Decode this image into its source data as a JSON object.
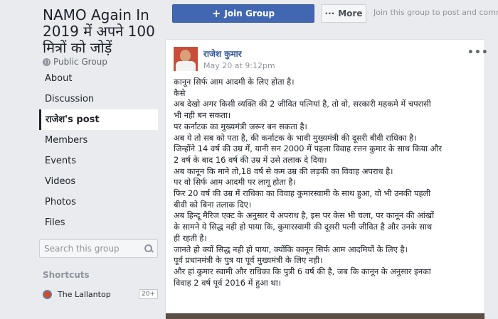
{
  "group": {
    "title": "NAMO Again In 2019 में अपने 100 मित्रों को जोड़ें",
    "type_label": "Public Group"
  },
  "nav": {
    "items": [
      {
        "label": "About"
      },
      {
        "label": "Discussion"
      },
      {
        "label": "राजेश's post"
      },
      {
        "label": "Members"
      },
      {
        "label": "Events"
      },
      {
        "label": "Videos"
      },
      {
        "label": "Photos"
      },
      {
        "label": "Files"
      }
    ],
    "active_index": 2
  },
  "search": {
    "placeholder": "Search this group"
  },
  "shortcuts": {
    "title": "Shortcuts",
    "items": [
      {
        "label": "The Lallantop",
        "badge": "20+"
      }
    ]
  },
  "topbar": {
    "join_label": "Join Group",
    "more_label": "More",
    "hint": "Join this group to post and comment"
  },
  "post": {
    "author": "राजेश कुमार",
    "timestamp": "May 20 at 9:12pm",
    "lines": [
      "कानून सिर्फ आम आदमी के लिए होता है।",
      "कैसे",
      "अब देखो अगर किसी व्यक्ति की 2 जीवित पत्नियां है, तो वो, सरकारी महकमे में चपरासी",
      "भी नही बन सकता।",
      "पर कर्नाटक का मुख्यमंत्री जरूर बन सकता है।",
      "अब ये तो सब को पता है, की कर्नाटक के भावी मुख्यमंत्री की दूसरी बीवी राधिका है।",
      "जिन्होंने 14 वर्ष की उम्र में, यानी सन 2000 में पहला विवाह रत्तन कुमार के साथ किया और",
      "2 वर्ष के बाद 16 वर्ष की उम्र में उसे तलाक दे दिया।",
      "अब कानून कि माने तो,18 वर्ष से कम उम्र की लड़की का विवाह अपराध है।",
      "पर वो सिर्फ आम आदमी पर लागू होता है।",
      "फिर 20 वर्ष की उम्र में राधिका का विवाह कुमारस्वामी के साथ हुआ, वो भी उनकी पहली",
      "बीवी को बिना तलाक दिए।",
      "अब हिन्दू मैरिज एक्ट के अनुसार ये अपराध है, इस पर केस भी चला, पर कानून की आंखों",
      "के सामने ये सिद्ध नही हो पाया कि, कुमारस्वामी की दूसरी पत्नी जीवित है और उनके साथ",
      "ही रहती है।",
      "जानते हो क्यों सिद्ध नही हो पाया, क्योंकि कानून सिर्फ आम आदमियों के लिए है।",
      "पूर्व प्रधानमंत्री के पुत्र या पूर्व मुख्यमंत्री के लिए नही।",
      "और हां कुमार स्वामी और राधिका कि पुत्री 6 वर्ष की है, जब कि कानून के अनुसार इनका",
      "विवाह 2 वर्ष पूर्व 2016 में हुआ था।"
    ]
  },
  "colors": {
    "page_bg": "#e9ebee",
    "brand_blue": "#4267b2",
    "link_blue": "#365899",
    "muted": "#90949c"
  }
}
